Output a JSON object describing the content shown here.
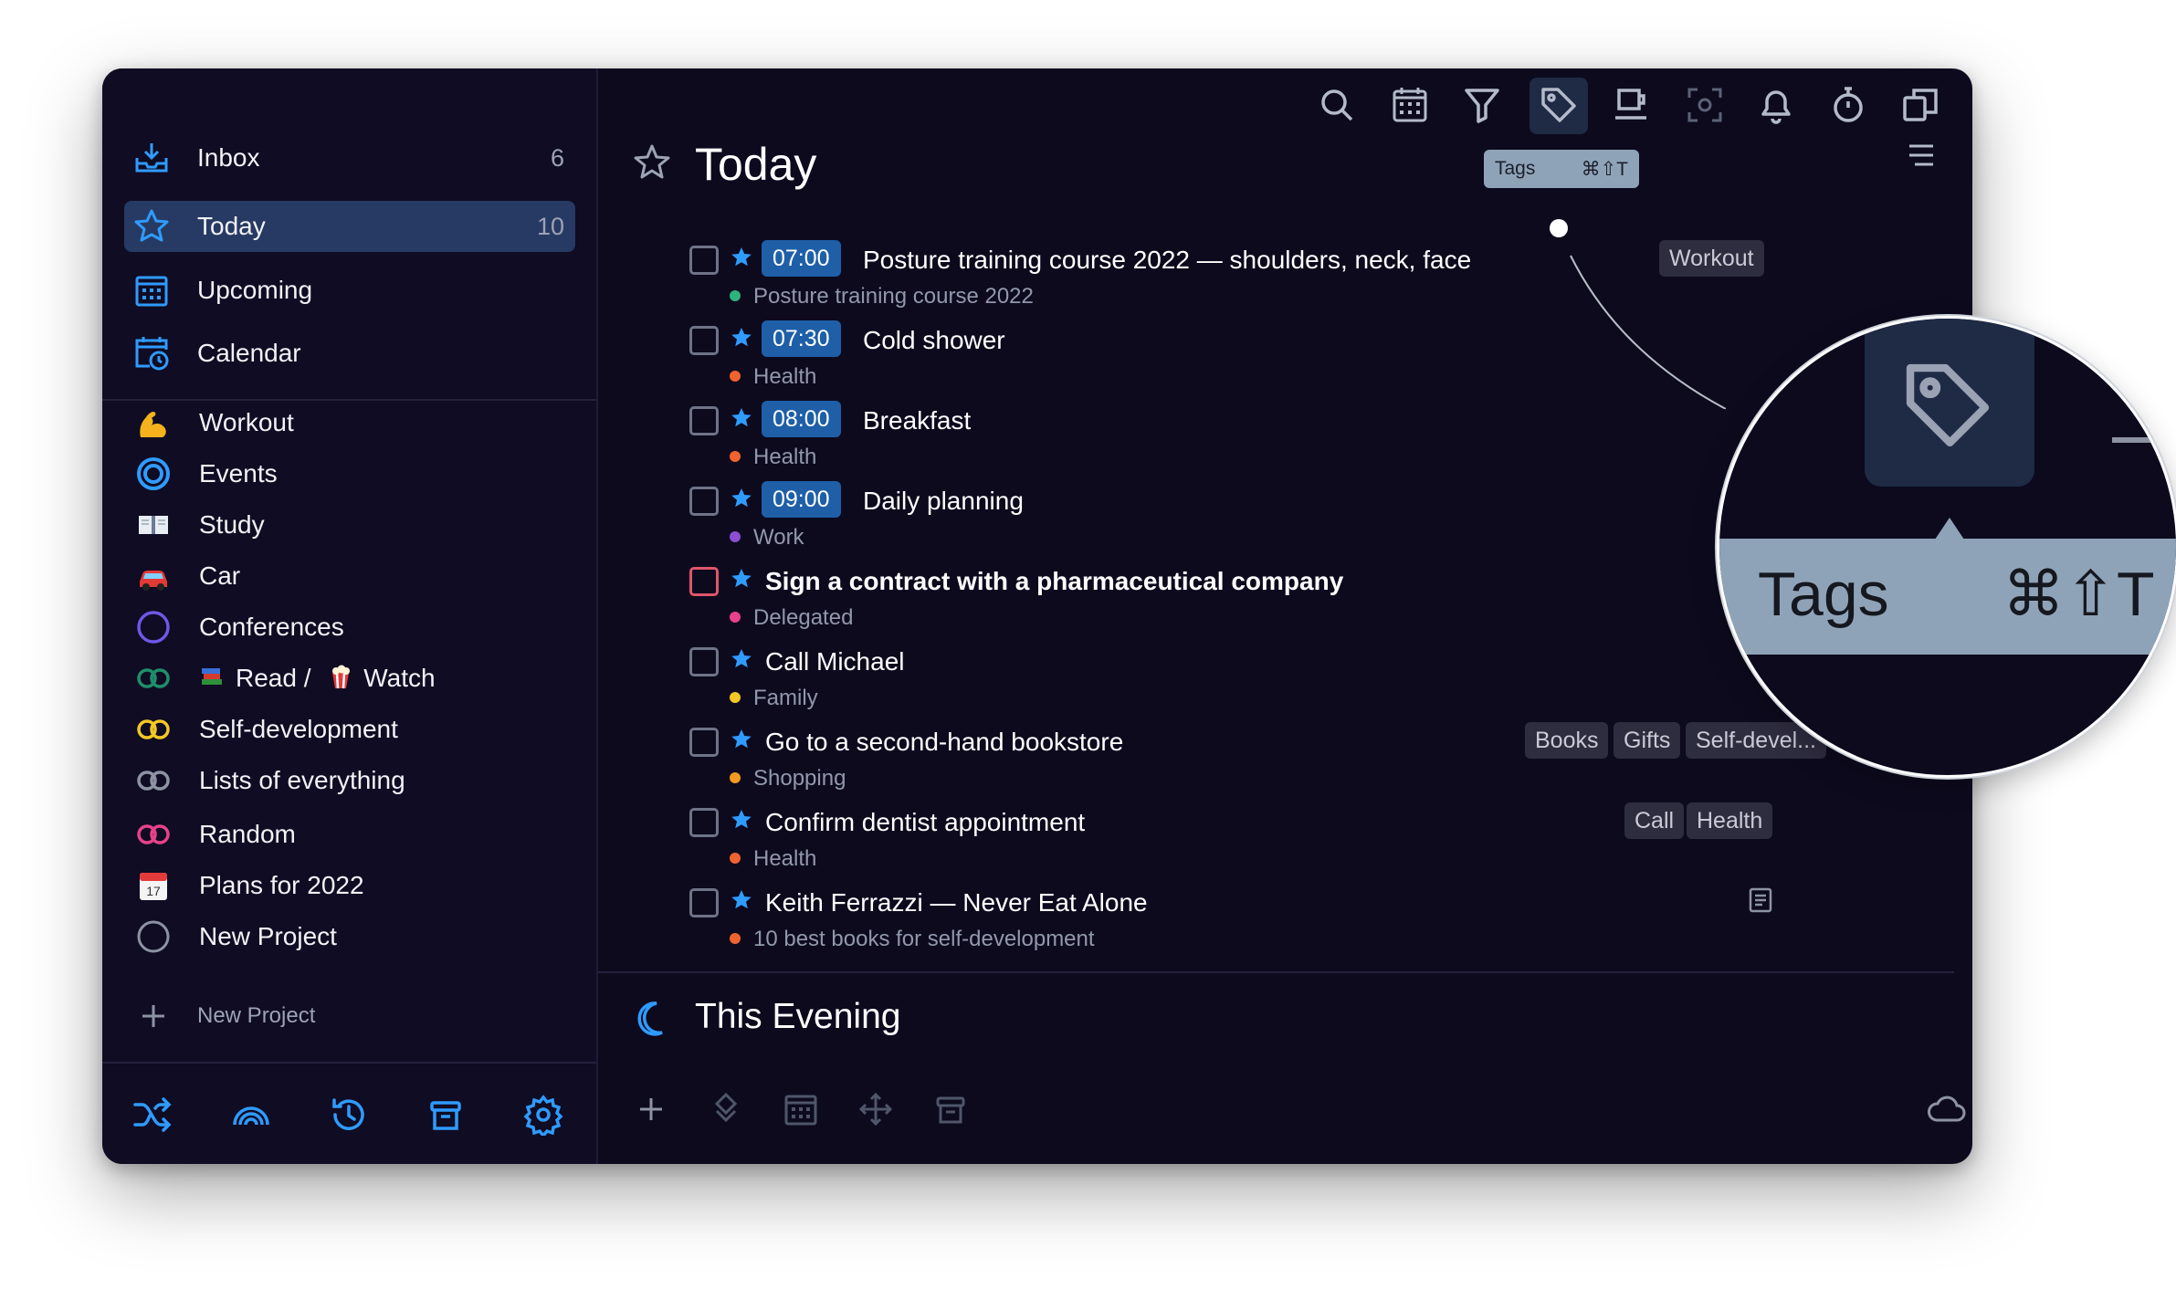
{
  "window": {
    "traffic_lights": [
      "#ff5f57",
      "#febc2e",
      "#28c840"
    ]
  },
  "sidebar": {
    "nav": [
      {
        "label": "Inbox",
        "count": "6"
      },
      {
        "label": "Today",
        "count": "10"
      },
      {
        "label": "Upcoming",
        "count": ""
      },
      {
        "label": "Calendar",
        "count": ""
      }
    ],
    "projects": [
      {
        "label": "Workout",
        "icon": "flexed-biceps-icon"
      },
      {
        "label": "Events",
        "icon": "blue-ring-icon"
      },
      {
        "label": "Study",
        "icon": "open-book-icon"
      },
      {
        "label": "Car",
        "icon": "car-icon"
      },
      {
        "label": "Conferences",
        "icon": "purple-ring-icon"
      },
      {
        "label": "Read /",
        "label2": "Watch",
        "icon": "green-loop-icon"
      },
      {
        "label": "Self-development",
        "icon": "yellow-loop-icon"
      },
      {
        "label": "Lists of everything",
        "icon": "gray-loop-icon"
      },
      {
        "label": "Random",
        "icon": "pink-loop-icon"
      },
      {
        "label": "Plans for 2022",
        "icon": "calendar-page-icon"
      },
      {
        "label": "New Project",
        "icon": "empty-circle-icon"
      }
    ],
    "new_project_label": "New Project"
  },
  "toolbar": {
    "tooltip_label": "Tags",
    "tooltip_shortcut": "⌘⇧T"
  },
  "main": {
    "title": "Today",
    "tasks": [
      {
        "time": "07:00",
        "title": "Posture training course 2022 — shoulders, neck, face",
        "sub": "Posture training course 2022",
        "dot": "#2fb37e",
        "tags": [
          "Workout"
        ]
      },
      {
        "time": "07:30",
        "title": "Cold shower",
        "sub": "Health",
        "dot": "#f0632e",
        "tags": []
      },
      {
        "time": "08:00",
        "title": "Breakfast",
        "sub": "Health",
        "dot": "#f0632e",
        "tags": []
      },
      {
        "time": "09:00",
        "title": "Daily planning",
        "sub": "Work",
        "dot": "#8b4fd3",
        "tags": []
      },
      {
        "time": "",
        "title": "Sign a contract with a pharmaceutical company",
        "sub": "Delegated",
        "dot": "#e8418a",
        "tags": [],
        "bold": true
      },
      {
        "time": "",
        "title": "Call Michael",
        "sub": "Family",
        "dot": "#f3c726",
        "tags": []
      },
      {
        "time": "",
        "title": "Go to a second-hand bookstore",
        "sub": "Shopping",
        "dot": "#f39a1f",
        "tags": [
          "Books",
          "Gifts",
          "Self-devel..."
        ]
      },
      {
        "time": "",
        "title": "Confirm dentist appointment",
        "sub": "Health",
        "dot": "#f0632e",
        "tags": [
          "Call",
          "Health"
        ]
      },
      {
        "time": "",
        "title": "Keith Ferrazzi — Never Eat Alone",
        "sub": "10 best books for self-development",
        "dot": "#f0632e",
        "tags": []
      }
    ],
    "evening_title": "This Evening"
  },
  "magnifier": {
    "tip_label": "Tags",
    "tip_shortcut": "⌘⇧T"
  },
  "colors": {
    "accent": "#2f9bff",
    "background": "#0d0a1e",
    "sidebar": "#0f0c23",
    "selected": "#263a63",
    "time_badge": "#1e5fa8"
  }
}
